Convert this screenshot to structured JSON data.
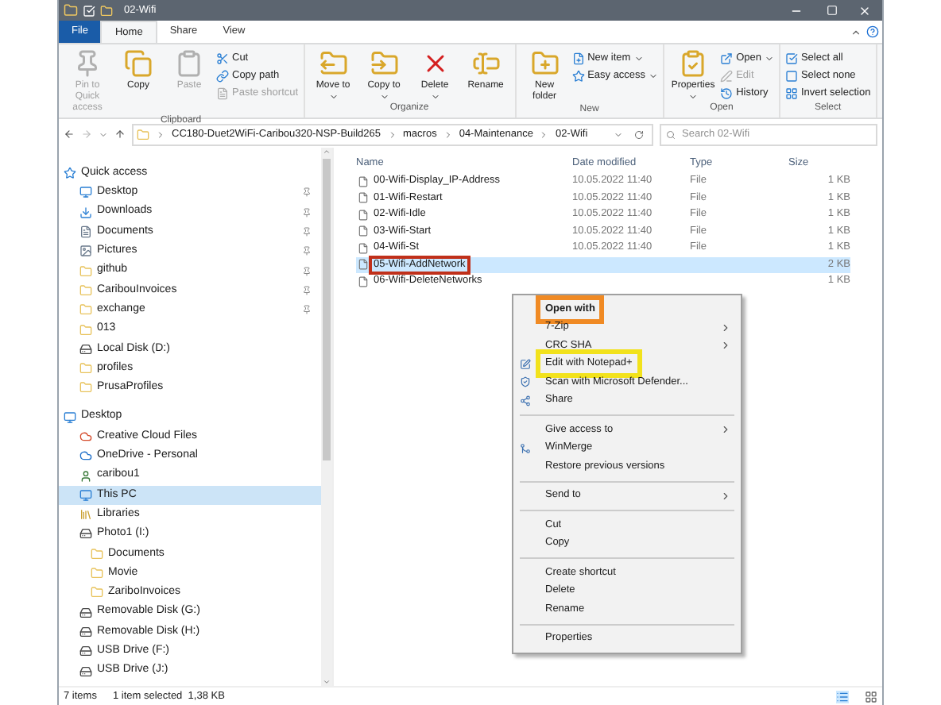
{
  "window": {
    "title": "02-Wifi"
  },
  "ribbon_tabs": [
    {
      "label": "File",
      "kind": "file",
      "selected": false
    },
    {
      "label": "Home",
      "kind": "tab",
      "selected": true
    },
    {
      "label": "Share",
      "kind": "tab",
      "selected": false
    },
    {
      "label": "View",
      "kind": "tab",
      "selected": false
    }
  ],
  "ribbon_groups": [
    {
      "label": "Clipboard",
      "buttons": [
        {
          "label": "Pin to Quick access",
          "kind": "large",
          "disabled": true
        },
        {
          "label": "Copy",
          "kind": "large",
          "disabled": false
        },
        {
          "label": "Paste",
          "kind": "large",
          "disabled": true
        },
        {
          "label": "Cut",
          "kind": "small",
          "disabled": false
        },
        {
          "label": "Copy path",
          "kind": "small",
          "disabled": false
        },
        {
          "label": "Paste shortcut",
          "kind": "small",
          "disabled": true
        }
      ]
    },
    {
      "label": "Organize",
      "buttons": [
        {
          "label": "Move to",
          "kind": "large",
          "disabled": false,
          "dropdown": true
        },
        {
          "label": "Copy to",
          "kind": "large",
          "disabled": false,
          "dropdown": true
        },
        {
          "label": "Delete",
          "kind": "large",
          "disabled": false,
          "dropdown": true
        },
        {
          "label": "Rename",
          "kind": "large",
          "disabled": false
        }
      ]
    },
    {
      "label": "New",
      "buttons": [
        {
          "label": "New folder",
          "kind": "large",
          "disabled": false
        },
        {
          "label": "New item",
          "kind": "small",
          "disabled": false,
          "dropdown": true
        },
        {
          "label": "Easy access",
          "kind": "small",
          "disabled": false,
          "dropdown": true
        }
      ]
    },
    {
      "label": "Open",
      "buttons": [
        {
          "label": "Properties",
          "kind": "large",
          "disabled": false,
          "dropdown": true
        },
        {
          "label": "Open",
          "kind": "small",
          "disabled": false,
          "dropdown": true
        },
        {
          "label": "Edit",
          "kind": "small",
          "disabled": true
        },
        {
          "label": "History",
          "kind": "small",
          "disabled": false
        }
      ]
    },
    {
      "label": "Select",
      "buttons": [
        {
          "label": "Select all",
          "kind": "small",
          "disabled": false
        },
        {
          "label": "Select none",
          "kind": "small",
          "disabled": false
        },
        {
          "label": "Invert selection",
          "kind": "small",
          "disabled": false
        }
      ]
    }
  ],
  "address": {
    "path": [
      "CC180-Duet2WiFi-Caribou320-NSP-Build265",
      "macros",
      "04-Maintenance",
      "02-Wifi"
    ],
    "search_placeholder": "Search 02-Wifi"
  },
  "nav": [
    {
      "label": "Quick access",
      "kind": "quick",
      "selected": false,
      "children": [
        {
          "label": "Desktop",
          "kind": "desktop",
          "pinned": true,
          "selected": false
        },
        {
          "label": "Downloads",
          "kind": "downloads",
          "pinned": true,
          "selected": false
        },
        {
          "label": "Documents",
          "kind": "documents",
          "pinned": true,
          "selected": false
        },
        {
          "label": "Pictures",
          "kind": "pictures",
          "pinned": true,
          "selected": false
        },
        {
          "label": "github",
          "kind": "folder",
          "pinned": true,
          "selected": false
        },
        {
          "label": "CaribouInvoices",
          "kind": "folder",
          "pinned": true,
          "selected": false
        },
        {
          "label": "exchange",
          "kind": "folder",
          "pinned": true,
          "selected": false
        },
        {
          "label": "013",
          "kind": "folder",
          "pinned": false,
          "selected": false
        },
        {
          "label": "Local Disk (D:)",
          "kind": "drive",
          "pinned": false,
          "selected": false
        },
        {
          "label": "profiles",
          "kind": "folder",
          "pinned": false,
          "selected": false
        },
        {
          "label": "PrusaProfiles",
          "kind": "folder",
          "pinned": false,
          "selected": false
        }
      ]
    },
    {
      "label": "Desktop",
      "kind": "desktop",
      "selected": false,
      "children": [
        {
          "label": "Creative Cloud Files",
          "kind": "cloud",
          "selected": false
        },
        {
          "label": "OneDrive - Personal",
          "kind": "onedrive",
          "selected": false
        },
        {
          "label": "caribou1",
          "kind": "user",
          "selected": false
        },
        {
          "label": "This PC",
          "kind": "pc",
          "selected": true
        },
        {
          "label": "Libraries",
          "kind": "libraries",
          "selected": false
        },
        {
          "label": "Photo1 (I:)",
          "kind": "drive",
          "selected": false,
          "children": [
            {
              "label": "Documents",
              "kind": "folder",
              "selected": false
            },
            {
              "label": "Movie",
              "kind": "folder",
              "selected": false
            },
            {
              "label": "ZariboInvoices",
              "kind": "folder",
              "selected": false
            }
          ]
        },
        {
          "label": "Removable Disk (G:)",
          "kind": "drive",
          "selected": false
        },
        {
          "label": "Removable Disk (H:)",
          "kind": "drive",
          "selected": false
        },
        {
          "label": "USB Drive (F:)",
          "kind": "drive",
          "selected": false
        },
        {
          "label": "USB Drive (J:)",
          "kind": "drive",
          "selected": false
        }
      ]
    }
  ],
  "files": {
    "columns": [
      "Name",
      "Date modified",
      "Type",
      "Size"
    ],
    "rows": [
      {
        "name": "00-Wifi-Display_IP-Address",
        "date": "10.05.2022 11:40",
        "type": "File",
        "size": "1 KB",
        "selected": false
      },
      {
        "name": "01-Wifi-Restart",
        "date": "10.05.2022 11:40",
        "type": "File",
        "size": "1 KB",
        "selected": false
      },
      {
        "name": "02-Wifi-Idle",
        "date": "10.05.2022 11:40",
        "type": "File",
        "size": "1 KB",
        "selected": false
      },
      {
        "name": "03-Wifi-Start",
        "date": "10.05.2022 11:40",
        "type": "File",
        "size": "1 KB",
        "selected": false
      },
      {
        "name": "04-Wifi-St",
        "date": "10.05.2022 11:40",
        "type": "File",
        "size": "1 KB",
        "selected": false
      },
      {
        "name": "05-Wifi-AddNetwork",
        "size": "2 KB",
        "selected": true,
        "color": "#c0301a"
      },
      {
        "name": "06-Wifi-DeleteNetworks",
        "size": "1 KB",
        "selected": false
      }
    ]
  },
  "context_menu": [
    {
      "kind": "item",
      "label": "Open with",
      "bold": true,
      "color": "#f08a24"
    },
    {
      "kind": "item",
      "label": "7-Zip",
      "submenu": true
    },
    {
      "kind": "item",
      "label": "CRC SHA",
      "submenu": true
    },
    {
      "kind": "notepad",
      "label": "Edit with Notepad+",
      "color": "#f2e21c"
    },
    {
      "kind": "shield",
      "label": "Scan with Microsoft Defender..."
    },
    {
      "kind": "share",
      "label": "Share"
    },
    {
      "kind": "separator"
    },
    {
      "kind": "item",
      "label": "Give access to",
      "submenu": true
    },
    {
      "kind": "merge",
      "label": "WinMerge"
    },
    {
      "kind": "item",
      "label": "Restore previous versions"
    },
    {
      "kind": "separator"
    },
    {
      "kind": "item",
      "label": "Send to",
      "submenu": true
    },
    {
      "kind": "separator"
    },
    {
      "kind": "item",
      "label": "Cut"
    },
    {
      "kind": "item",
      "label": "Copy"
    },
    {
      "kind": "separator"
    },
    {
      "kind": "item",
      "label": "Create shortcut"
    },
    {
      "kind": "item",
      "label": "Delete"
    },
    {
      "kind": "item",
      "label": "Rename"
    },
    {
      "kind": "separator"
    },
    {
      "kind": "item",
      "label": "Properties"
    }
  ],
  "status_bar": {
    "count": "7 items",
    "selection": "1 item selected  1,38 KB"
  }
}
